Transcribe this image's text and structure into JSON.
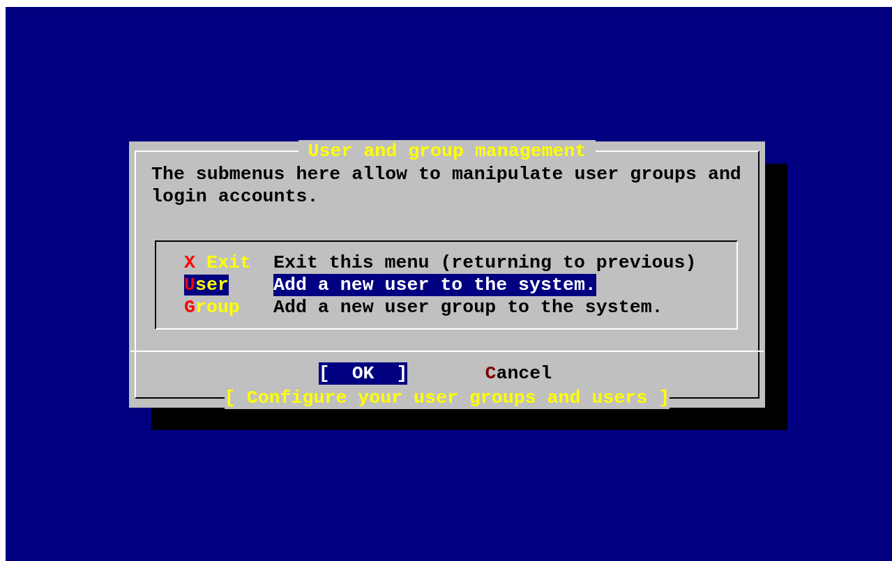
{
  "dialog": {
    "title": "User and group management",
    "message": "The submenus here allow to manipulate user groups and login accounts.",
    "menu": [
      {
        "name": "X Exit",
        "description": "Exit this menu (returning to previous)",
        "selected": false
      },
      {
        "name": "User",
        "description": "Add a new user to the system.",
        "selected": true
      },
      {
        "name": "Group",
        "description": "Add a new user group to the system.",
        "selected": false
      }
    ],
    "buttons": [
      {
        "label": "[  OK  ]",
        "selected": true
      },
      {
        "label": "Cancel",
        "selected": false
      }
    ],
    "footer": "[ Configure your user groups and users ]"
  }
}
